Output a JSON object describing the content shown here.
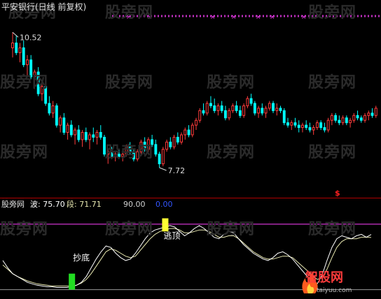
{
  "header": {
    "title": "平安银行(日线 前复权)"
  },
  "watermark": "股旁网",
  "logo": {
    "name": "智股网",
    "url": "taiyuu.com"
  },
  "price_panel": {
    "high_label": "10.52",
    "low_label": "7.72",
    "marker": "$"
  },
  "indicator_panel": {
    "name": "股旁网",
    "wave_label": "波: 75.70",
    "segment_label": "段: 71.71",
    "level_high": "90.00",
    "level_low": "0.00",
    "signal_bottom": "抄底",
    "signal_top": "逃顶"
  },
  "colors": {
    "up": "#ff3c3c",
    "down": "#00ffff",
    "magenta": "#ff40ff",
    "separator": "#b00000",
    "wave": "#ffffff",
    "segment": "#e8e8b0",
    "bottom_bar": "#22dd22",
    "top_bar": "#ffff33",
    "level_low_color": "#3355ff"
  },
  "chart_data": [
    {
      "type": "candlestick",
      "title": "平安银行(日线 前复权)",
      "ylim": [
        7.2,
        10.9
      ],
      "annotations": [
        {
          "label": "10.52",
          "at": "max",
          "value": 10.52
        },
        {
          "label": "7.72",
          "at": "min",
          "value": 7.72
        }
      ],
      "candles": [
        [
          10.2,
          10.52,
          10.0,
          10.3
        ],
        [
          10.3,
          10.45,
          10.05,
          10.1
        ],
        [
          10.1,
          10.3,
          9.9,
          10.2
        ],
        [
          10.2,
          10.35,
          9.8,
          9.85
        ],
        [
          9.85,
          10.05,
          9.6,
          9.95
        ],
        [
          9.95,
          10.05,
          9.55,
          9.6
        ],
        [
          9.6,
          9.75,
          9.35,
          9.7
        ],
        [
          9.7,
          9.8,
          9.2,
          9.25
        ],
        [
          9.25,
          9.45,
          9.1,
          9.4
        ],
        [
          9.4,
          9.5,
          9.0,
          9.05
        ],
        [
          9.05,
          9.2,
          8.8,
          8.85
        ],
        [
          8.85,
          9.1,
          8.75,
          9.0
        ],
        [
          9.0,
          9.05,
          8.55,
          8.6
        ],
        [
          8.6,
          8.8,
          8.45,
          8.75
        ],
        [
          8.75,
          8.85,
          8.4,
          8.45
        ],
        [
          8.45,
          8.65,
          8.3,
          8.6
        ],
        [
          8.6,
          8.7,
          8.35,
          8.4
        ],
        [
          8.4,
          8.55,
          8.2,
          8.5
        ],
        [
          8.5,
          8.6,
          8.25,
          8.3
        ],
        [
          8.3,
          8.5,
          8.15,
          8.45
        ],
        [
          8.45,
          8.55,
          8.25,
          8.3
        ],
        [
          8.3,
          8.45,
          8.1,
          8.4
        ],
        [
          8.4,
          8.55,
          8.25,
          8.35
        ],
        [
          8.35,
          8.5,
          8.2,
          8.45
        ],
        [
          8.45,
          8.6,
          8.3,
          8.35
        ],
        [
          8.35,
          8.4,
          7.95,
          8.0
        ],
        [
          8.0,
          8.1,
          7.8,
          8.05
        ],
        [
          8.05,
          8.15,
          7.9,
          7.95
        ],
        [
          7.95,
          8.05,
          7.85,
          8.0
        ],
        [
          8.0,
          8.1,
          7.9,
          7.95
        ],
        [
          7.95,
          8.05,
          7.85,
          8.0
        ],
        [
          8.0,
          8.2,
          7.95,
          8.15
        ],
        [
          8.15,
          8.25,
          8.0,
          8.05
        ],
        [
          8.05,
          8.1,
          7.85,
          7.9
        ],
        [
          7.9,
          8.1,
          7.85,
          8.05
        ],
        [
          8.05,
          8.3,
          8.0,
          8.25
        ],
        [
          8.25,
          8.35,
          8.05,
          8.1
        ],
        [
          8.1,
          8.35,
          8.05,
          8.3
        ],
        [
          8.3,
          8.4,
          8.15,
          8.2
        ],
        [
          8.2,
          8.3,
          7.95,
          8.0
        ],
        [
          8.0,
          8.05,
          7.72,
          7.8
        ],
        [
          7.8,
          8.15,
          7.75,
          8.1
        ],
        [
          8.1,
          8.3,
          8.05,
          8.25
        ],
        [
          8.25,
          8.35,
          8.1,
          8.15
        ],
        [
          8.15,
          8.4,
          8.1,
          8.35
        ],
        [
          8.35,
          8.45,
          8.2,
          8.25
        ],
        [
          8.25,
          8.45,
          8.2,
          8.4
        ],
        [
          8.4,
          8.55,
          8.3,
          8.5
        ],
        [
          8.5,
          8.6,
          8.35,
          8.4
        ],
        [
          8.4,
          8.65,
          8.35,
          8.6
        ],
        [
          8.6,
          8.75,
          8.5,
          8.7
        ],
        [
          8.7,
          8.95,
          8.65,
          8.9
        ],
        [
          8.9,
          9.05,
          8.8,
          8.85
        ],
        [
          8.85,
          9.1,
          8.8,
          9.05
        ],
        [
          9.05,
          9.2,
          8.95,
          9.0
        ],
        [
          9.0,
          9.15,
          8.85,
          8.9
        ],
        [
          8.9,
          9.05,
          8.8,
          9.0
        ],
        [
          9.0,
          9.1,
          8.85,
          8.9
        ],
        [
          8.9,
          9.0,
          8.7,
          8.75
        ],
        [
          8.75,
          8.95,
          8.7,
          8.9
        ],
        [
          8.9,
          9.05,
          8.85,
          9.0
        ],
        [
          9.0,
          9.1,
          8.85,
          8.9
        ],
        [
          8.9,
          9.0,
          8.75,
          8.8
        ],
        [
          8.8,
          9.05,
          8.75,
          9.0
        ],
        [
          9.0,
          9.2,
          8.95,
          9.15
        ],
        [
          9.15,
          9.25,
          9.0,
          9.05
        ],
        [
          9.05,
          9.1,
          8.8,
          8.85
        ],
        [
          8.85,
          9.0,
          8.75,
          8.95
        ],
        [
          8.95,
          9.05,
          8.8,
          8.85
        ],
        [
          8.85,
          9.0,
          8.75,
          8.95
        ],
        [
          8.95,
          9.1,
          8.9,
          9.05
        ],
        [
          9.05,
          9.1,
          8.85,
          8.9
        ],
        [
          8.9,
          9.05,
          8.8,
          8.95
        ],
        [
          8.95,
          9.0,
          8.85,
          8.9
        ],
        [
          8.9,
          8.95,
          8.6,
          8.65
        ],
        [
          8.65,
          8.75,
          8.55,
          8.6
        ],
        [
          8.6,
          8.7,
          8.5,
          8.65
        ],
        [
          8.65,
          8.75,
          8.55,
          8.6
        ],
        [
          8.6,
          8.7,
          8.45,
          8.55
        ],
        [
          8.55,
          8.65,
          8.45,
          8.6
        ],
        [
          8.6,
          8.7,
          8.5,
          8.55
        ],
        [
          8.55,
          8.65,
          8.45,
          8.5
        ],
        [
          8.5,
          8.6,
          8.4,
          8.55
        ],
        [
          8.55,
          8.7,
          8.5,
          8.65
        ],
        [
          8.65,
          8.7,
          8.5,
          8.55
        ],
        [
          8.55,
          8.65,
          8.45,
          8.5
        ],
        [
          8.5,
          8.75,
          8.45,
          8.7
        ],
        [
          8.7,
          8.85,
          8.6,
          8.8
        ],
        [
          8.8,
          8.85,
          8.65,
          8.7
        ],
        [
          8.7,
          8.8,
          8.6,
          8.65
        ],
        [
          8.65,
          8.8,
          8.6,
          8.75
        ],
        [
          8.75,
          8.8,
          8.6,
          8.65
        ],
        [
          8.65,
          8.75,
          8.55,
          8.7
        ],
        [
          8.7,
          8.85,
          8.65,
          8.8
        ],
        [
          8.8,
          8.9,
          8.7,
          8.75
        ],
        [
          8.75,
          8.8,
          8.65,
          8.7
        ],
        [
          8.7,
          8.85,
          8.65,
          8.8
        ],
        [
          8.8,
          8.9,
          8.7,
          8.85
        ],
        [
          8.85,
          8.95,
          8.75,
          8.8
        ],
        [
          8.8,
          9.0,
          8.75,
          8.95
        ]
      ]
    },
    {
      "type": "line",
      "ylim": [
        -10,
        110
      ],
      "levels": [
        90,
        0
      ],
      "series": [
        {
          "name": "波",
          "values": [
            40,
            30,
            22,
            18,
            14,
            10,
            8,
            6,
            5,
            4,
            4,
            3,
            3,
            3,
            4,
            6,
            10,
            18,
            30,
            42,
            52,
            60,
            58,
            50,
            44,
            40,
            42,
            50,
            60,
            70,
            78,
            82,
            84,
            86,
            88,
            86,
            80,
            74,
            78,
            84,
            88,
            84,
            78,
            72,
            70,
            76,
            80,
            78,
            70,
            62,
            56,
            50,
            46,
            42,
            40,
            44,
            50,
            52,
            48,
            42,
            34,
            26,
            18,
            12,
            8,
            20,
            40,
            58,
            70,
            74,
            72,
            70,
            74,
            76,
            72,
            75.7
          ]
        },
        {
          "name": "段",
          "values": [
            34,
            28,
            22,
            18,
            15,
            12,
            10,
            8,
            7,
            6,
            5,
            5,
            5,
            5,
            5,
            6,
            9,
            14,
            22,
            32,
            42,
            52,
            56,
            54,
            50,
            46,
            44,
            46,
            54,
            62,
            70,
            76,
            80,
            82,
            84,
            84,
            82,
            78,
            78,
            80,
            82,
            82,
            80,
            76,
            72,
            72,
            74,
            74,
            70,
            64,
            58,
            52,
            48,
            44,
            42,
            42,
            44,
            46,
            46,
            44,
            38,
            32,
            26,
            20,
            14,
            16,
            28,
            44,
            58,
            66,
            70,
            70,
            70,
            72,
            72,
            71.71
          ]
        }
      ],
      "signals": [
        {
          "label": "抄底",
          "index": 14
        },
        {
          "label": "逃顶",
          "index": 33
        }
      ]
    }
  ]
}
